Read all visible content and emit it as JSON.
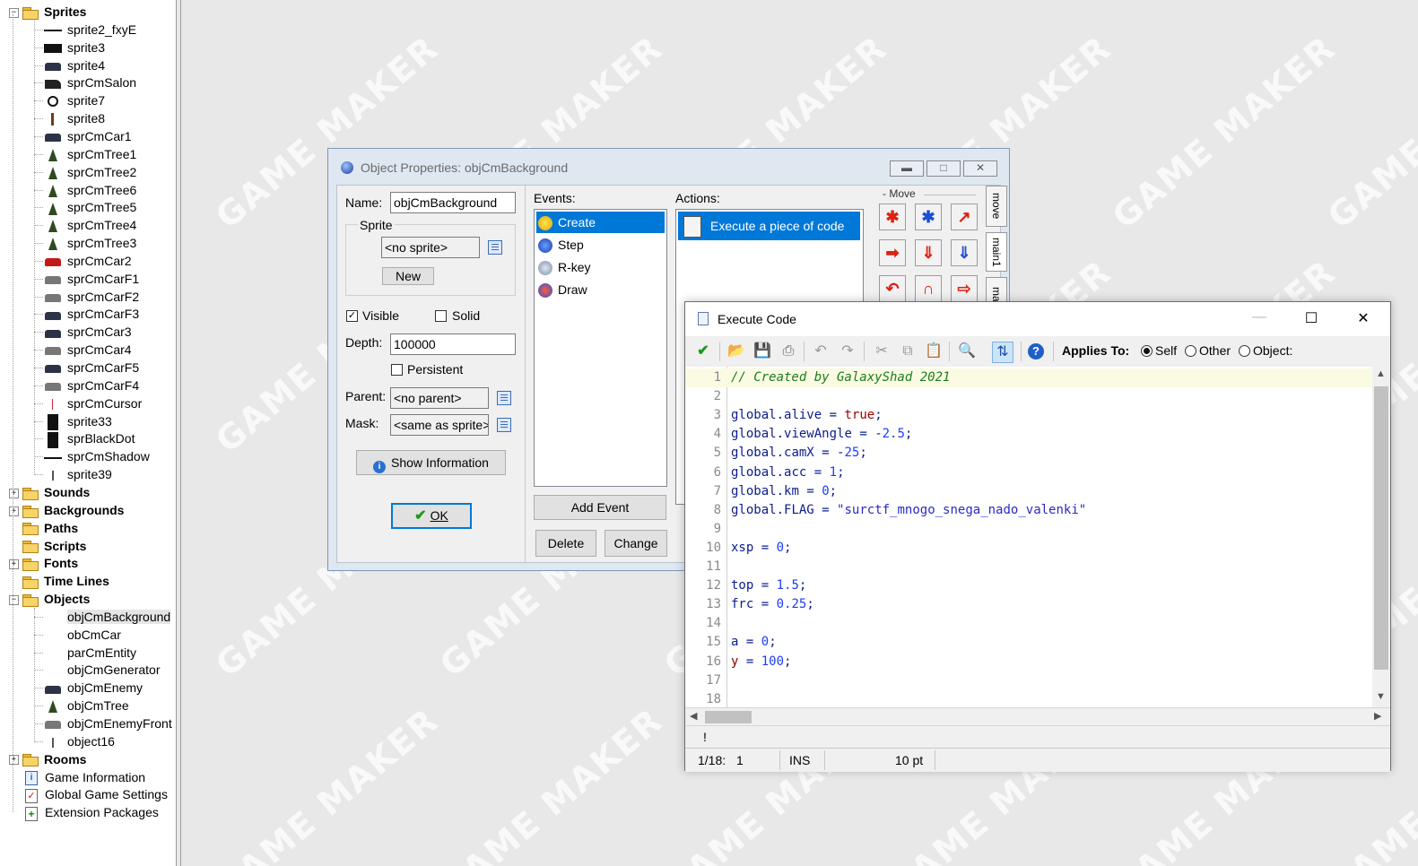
{
  "tree": {
    "sprites_label": "Sprites",
    "sprites": [
      {
        "name": "sprite2_fxyE",
        "icon": "line"
      },
      {
        "name": "sprite3",
        "icon": "block"
      },
      {
        "name": "sprite4",
        "icon": "car"
      },
      {
        "name": "sprCmSalon",
        "icon": "salon"
      },
      {
        "name": "sprite7",
        "icon": "wheel"
      },
      {
        "name": "sprite8",
        "icon": "post"
      },
      {
        "name": "sprCmCar1",
        "icon": "car"
      },
      {
        "name": "sprCmTree1",
        "icon": "tree"
      },
      {
        "name": "sprCmTree2",
        "icon": "tree"
      },
      {
        "name": "sprCmTree6",
        "icon": "tree"
      },
      {
        "name": "sprCmTree5",
        "icon": "tree"
      },
      {
        "name": "sprCmTree4",
        "icon": "tree"
      },
      {
        "name": "sprCmTree3",
        "icon": "tree"
      },
      {
        "name": "sprCmCar2",
        "icon": "car-red"
      },
      {
        "name": "sprCmCarF1",
        "icon": "car-grey"
      },
      {
        "name": "sprCmCarF2",
        "icon": "car-grey"
      },
      {
        "name": "sprCmCarF3",
        "icon": "car"
      },
      {
        "name": "sprCmCar3",
        "icon": "car"
      },
      {
        "name": "sprCmCar4",
        "icon": "car-grey"
      },
      {
        "name": "sprCmCarF5",
        "icon": "car"
      },
      {
        "name": "sprCmCarF4",
        "icon": "car-grey"
      },
      {
        "name": "sprCmCursor",
        "icon": "cursor"
      },
      {
        "name": "sprite33",
        "icon": "tall"
      },
      {
        "name": "sprBlackDot",
        "icon": "tall"
      },
      {
        "name": "sprCmShadow",
        "icon": "line"
      },
      {
        "name": "sprite39",
        "icon": "pin"
      }
    ],
    "sounds": "Sounds",
    "backgrounds": "Backgrounds",
    "paths": "Paths",
    "scripts": "Scripts",
    "fonts": "Fonts",
    "time_lines": "Time Lines",
    "objects_label": "Objects",
    "objects": [
      {
        "name": "objCmBackground",
        "icon": "none"
      },
      {
        "name": "obCmCar",
        "icon": "none"
      },
      {
        "name": "parCmEntity",
        "icon": "none"
      },
      {
        "name": "objCmGenerator",
        "icon": "none"
      },
      {
        "name": "objCmEnemy",
        "icon": "car"
      },
      {
        "name": "objCmTree",
        "icon": "tree"
      },
      {
        "name": "objCmEnemyFront",
        "icon": "car-grey"
      },
      {
        "name": "object16",
        "icon": "pin"
      }
    ],
    "rooms": "Rooms",
    "game_information": "Game Information",
    "global_game_settings": "Global Game Settings",
    "extension_packages": "Extension Packages"
  },
  "watermark": "GAME MAKER",
  "object_window": {
    "title": "Object Properties: objCmBackground",
    "name_label": "Name:",
    "name_value": "objCmBackground",
    "sprite_label": "Sprite",
    "sprite_value": "<no sprite>",
    "new_button": "New",
    "visible_label": "Visible",
    "visible_checked": true,
    "solid_label": "Solid",
    "solid_checked": false,
    "depth_label": "Depth:",
    "depth_value": "100000",
    "persistent_label": "Persistent",
    "parent_label": "Parent:",
    "parent_value": "<no parent>",
    "mask_label": "Mask:",
    "mask_value": "<same as sprite>",
    "show_info_button": "Show Information",
    "ok_button": "OK",
    "events_label": "Events:",
    "events": [
      "Create",
      "Step",
      "R-key",
      "Draw"
    ],
    "add_event_button": "Add Event",
    "delete_button": "Delete",
    "change_button": "Change",
    "actions_label": "Actions:",
    "actions": [
      "Execute a piece of code"
    ],
    "library_group": "Move",
    "tabs": [
      "move",
      "main1",
      "ma"
    ]
  },
  "code_window": {
    "title": "Execute Code",
    "applies_to_label": "Applies To:",
    "applies_options": [
      "Self",
      "Other",
      "Object:"
    ],
    "applies_selected": "Self",
    "lines": [
      "// Created by GalaxyShad 2021",
      "",
      "global.alive = true;",
      "global.viewAngle = -2.5;",
      "global.camX = -25;",
      "global.acc = 1;",
      "global.km = 0;",
      "global.FLAG = \"surctf_mnogo_snega_nado_valenki\"",
      "",
      "xsp = 0;",
      "",
      "top = 1.5;",
      "frc = 0.25;",
      "",
      "a = 0;",
      "y = 100;",
      "",
      ""
    ],
    "message": "!",
    "status_position": "1/18:",
    "status_col": "1",
    "status_mode": "INS",
    "status_font": "10 pt"
  }
}
